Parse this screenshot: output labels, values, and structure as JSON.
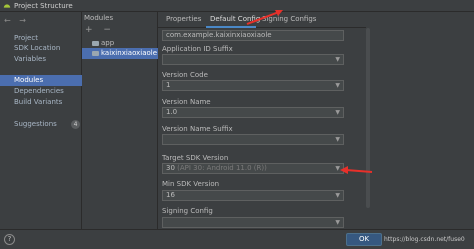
{
  "window": {
    "title": "Project Structure"
  },
  "sidebar": {
    "nav_back": "←",
    "nav_forward": "→",
    "items": [
      {
        "label": "Project"
      },
      {
        "label": "SDK Location"
      },
      {
        "label": "Variables"
      },
      {
        "label": "Modules"
      },
      {
        "label": "Dependencies"
      },
      {
        "label": "Build Variants"
      },
      {
        "label": "Suggestions",
        "badge": "4"
      }
    ],
    "selected": "Modules"
  },
  "modules_panel": {
    "header": "Modules",
    "add": "+",
    "remove": "−",
    "items": [
      {
        "label": "app"
      },
      {
        "label": "kaixinxiaoxiaole"
      }
    ],
    "selected": "kaixinxiaoxiaole"
  },
  "tabs": [
    {
      "label": "Properties"
    },
    {
      "label": "Default Config"
    },
    {
      "label": "Signing Configs"
    }
  ],
  "active_tab": "Default Config",
  "fields": {
    "application_id": {
      "value": "com.example.kaixinxiaoxiaole"
    },
    "application_id_suffix": {
      "label": "Application ID Suffix",
      "value": ""
    },
    "version_code": {
      "label": "Version Code",
      "value": "1"
    },
    "version_name": {
      "label": "Version Name",
      "value": "1.0"
    },
    "version_name_suffix": {
      "label": "Version Name Suffix",
      "value": ""
    },
    "target_sdk": {
      "label": "Target SDK Version",
      "value": "30",
      "hint": "(API 30: Android 11.0 (R))"
    },
    "min_sdk": {
      "label": "Min SDK Version",
      "value": "16"
    },
    "signing_config": {
      "label": "Signing Config",
      "value": ""
    }
  },
  "buttons": {
    "ok": "OK",
    "help": "?"
  },
  "watermark": "https://blog.csdn.net/fuse0",
  "colors": {
    "background": "#3c3f41",
    "selection": "#4b6eaf",
    "annotation_arrow": "#e8302a"
  },
  "icons": {
    "app": "android-icon",
    "module": "folder-icon"
  }
}
